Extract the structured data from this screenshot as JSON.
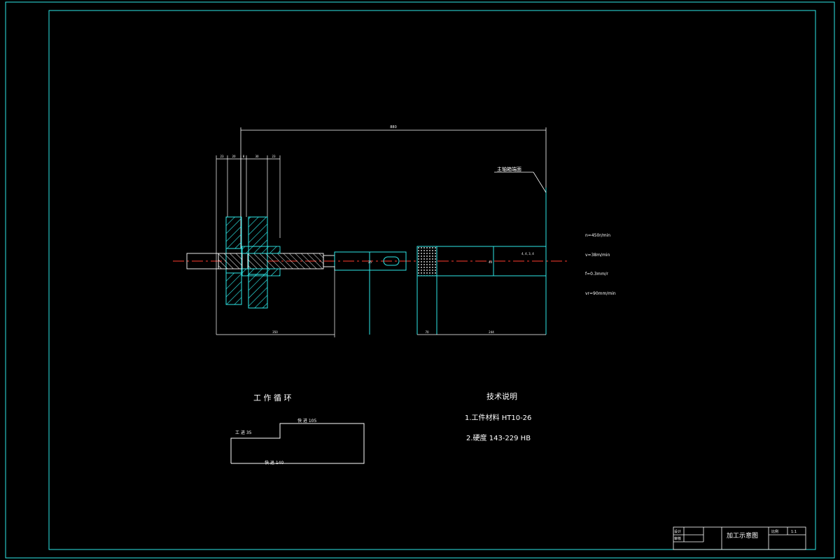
{
  "drawing": {
    "top_overall_dim": "880",
    "tool_name_callout": "主轴箱端面",
    "top_small_dims": [
      "23",
      "20",
      "8",
      "30",
      "23"
    ],
    "bottom_dims": [
      "350",
      "70",
      "244"
    ],
    "shaft_diameter_labels": [
      "25",
      "40"
    ],
    "inner_bore_label": "4, 4, 3, 4",
    "params": [
      "n=450r/min",
      "v=38m/min",
      "f=0.3mm/r",
      "vr=90mm/min"
    ]
  },
  "work_cycle": {
    "title": "工 作 循 环",
    "fast_forward": "快  进 105",
    "work_feed": "工  进 35",
    "fast_return": "快    退 140"
  },
  "tech_notes": {
    "title": "技术说明",
    "line1": "1.工件材料 HT10-26",
    "line2": "2.硬度 143-229 HB"
  },
  "title_block": {
    "designer_label": "设计",
    "checker_label": "审核",
    "drawing_title": "加工示意图",
    "scale_label": "比例",
    "scale_value": "1:1"
  },
  "colors": {
    "border": "#2ee8e8",
    "lines": "#ffffff",
    "centerline": "#ff3b30",
    "hatch": "#2ee8e8"
  }
}
